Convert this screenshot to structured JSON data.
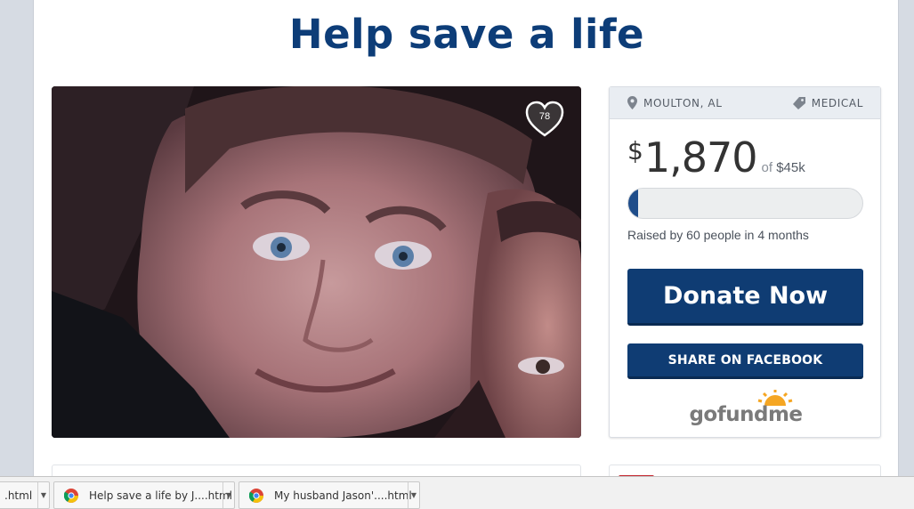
{
  "page": {
    "title": "Help save a life"
  },
  "campaign": {
    "likes": "78",
    "location": "MOULTON, AL",
    "category": "MEDICAL",
    "currency": "$",
    "amount": "1,870",
    "goal_prefix": "of",
    "goal": "$45k",
    "progress_fraction": 0.04,
    "raised_prefix": "Raised by",
    "donors": "60",
    "raised_mid": "people in",
    "duration": "4 months",
    "donate_label": "Donate Now",
    "share_label": "SHARE ON FACEBOOK",
    "logo": {
      "go": "go",
      "fund": "fund",
      "me": "me"
    }
  },
  "downloads": [
    {
      "label": ".html",
      "icon": "chrome-icon"
    },
    {
      "label": "Help save a life by J....html",
      "icon": "chrome-icon"
    },
    {
      "label": "My husband Jason'....html",
      "icon": "chrome-icon"
    }
  ],
  "colors": {
    "brand_navy": "#0f3c73",
    "title_blue": "#0d3d78",
    "progress": "#1f4d8a",
    "logo_orange": "#f5a623"
  }
}
